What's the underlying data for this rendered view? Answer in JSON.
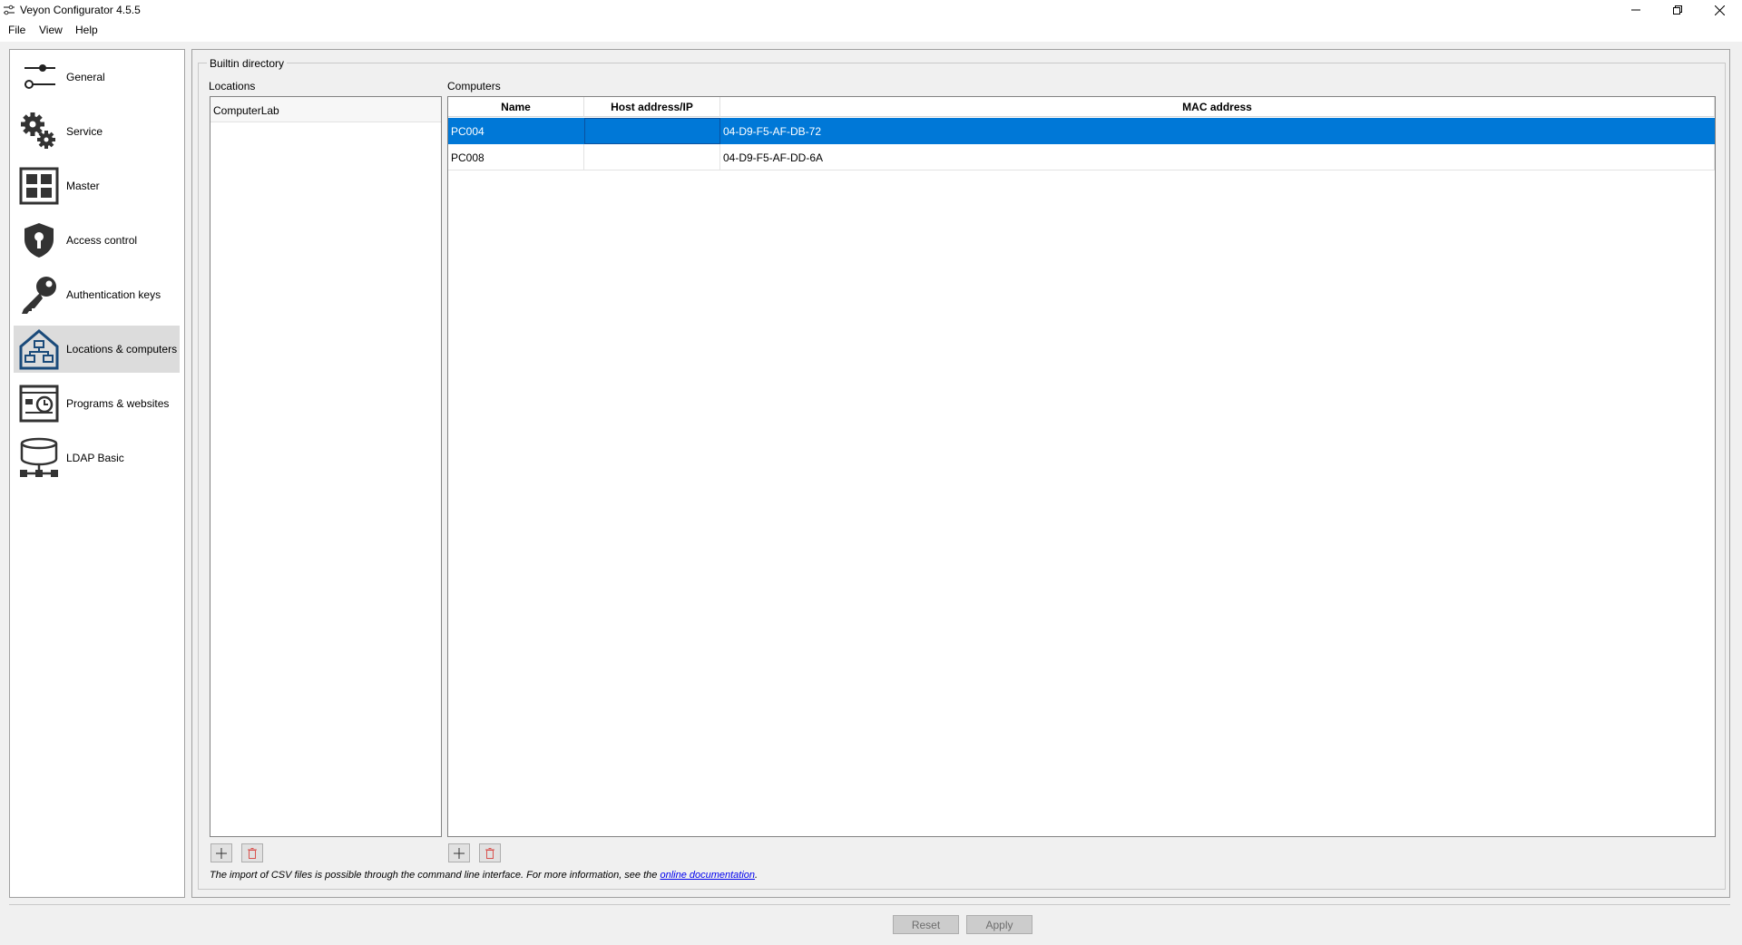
{
  "window": {
    "title": "Veyon Configurator 4.5.5"
  },
  "menu": [
    "File",
    "View",
    "Help"
  ],
  "sidebar": {
    "items": [
      {
        "label": "General",
        "icon": "sliders-icon"
      },
      {
        "label": "Service",
        "icon": "gears-icon"
      },
      {
        "label": "Master",
        "icon": "grid-icon"
      },
      {
        "label": "Access control",
        "icon": "shield-icon"
      },
      {
        "label": "Authentication keys",
        "icon": "key-icon"
      },
      {
        "label": "Locations & computers",
        "icon": "house-network-icon",
        "active": true
      },
      {
        "label": "Programs & websites",
        "icon": "window-clock-icon"
      },
      {
        "label": "LDAP Basic",
        "icon": "database-network-icon"
      }
    ]
  },
  "main": {
    "group_title": "Builtin directory",
    "locations_label": "Locations",
    "computers_label": "Computers",
    "locations": [
      "ComputerLab"
    ],
    "columns": [
      "Name",
      "Host address/IP",
      "MAC address"
    ],
    "computers": [
      {
        "name": "PC004",
        "host": "",
        "mac": "04-D9-F5-AF-DB-72",
        "selected": true
      },
      {
        "name": "PC008",
        "host": "",
        "mac": "04-D9-F5-AF-DD-6A",
        "selected": false
      }
    ],
    "csv_note_text": "The import of CSV files is possible through the command line interface. For more information, see the ",
    "csv_note_link": "online documentation",
    "csv_note_end": "."
  },
  "buttons": {
    "reset": "Reset",
    "apply": "Apply"
  },
  "colors": {
    "selection": "#0078d7",
    "delete_icon": "#d9534f"
  }
}
